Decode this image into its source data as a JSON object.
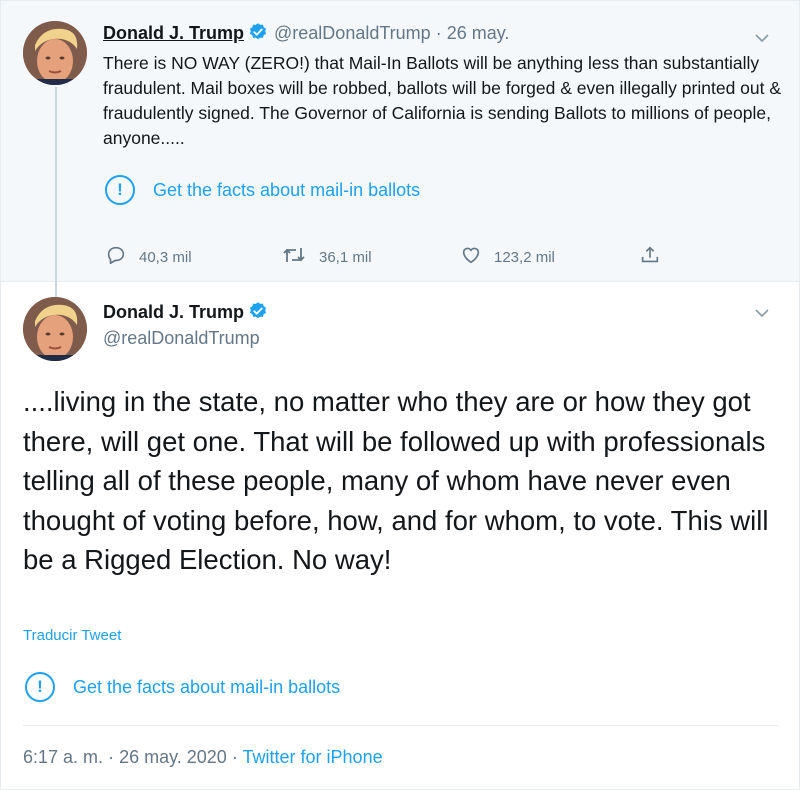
{
  "colors": {
    "accent": "#1da1f2",
    "text": "#14171a",
    "muted": "#657786",
    "parent_bg": "#f5f8fa"
  },
  "parent_tweet": {
    "author_name": "Donald J. Trump",
    "handle": "@realDonaldTrump",
    "separator": "·",
    "date": "26 may.",
    "text": "There is NO WAY (ZERO!) that Mail-In Ballots will be anything less than substantially fraudulent. Mail boxes will be robbed, ballots will be forged & even illegally printed out & fraudulently signed. The Governor of California is sending Ballots to millions of people, anyone.....",
    "facts_label": "Get the facts about mail-in ballots",
    "replies": "40,3 mil",
    "retweets": "36,1 mil",
    "likes": "123,2 mil"
  },
  "main_tweet": {
    "author_name": "Donald J. Trump",
    "handle": "@realDonaldTrump",
    "text": "....living in the state, no matter who they are or how they got there, will get one. That will be followed up with professionals telling all of these people, many of whom have never even thought of voting before, how, and for whom, to vote. This will be a Rigged Election. No way!",
    "translate_label": "Traducir Tweet",
    "facts_label": "Get the facts about mail-in ballots",
    "time": "6:17 a. m.",
    "separator": "·",
    "full_date": "26 may. 2020",
    "source": "Twitter for iPhone"
  },
  "icons": {
    "verified": "verified-badge-icon",
    "chevron": "chevron-down-icon",
    "facts": "exclamation-circle-icon",
    "reply": "reply-icon",
    "retweet": "retweet-icon",
    "like": "heart-icon",
    "share": "share-icon"
  }
}
